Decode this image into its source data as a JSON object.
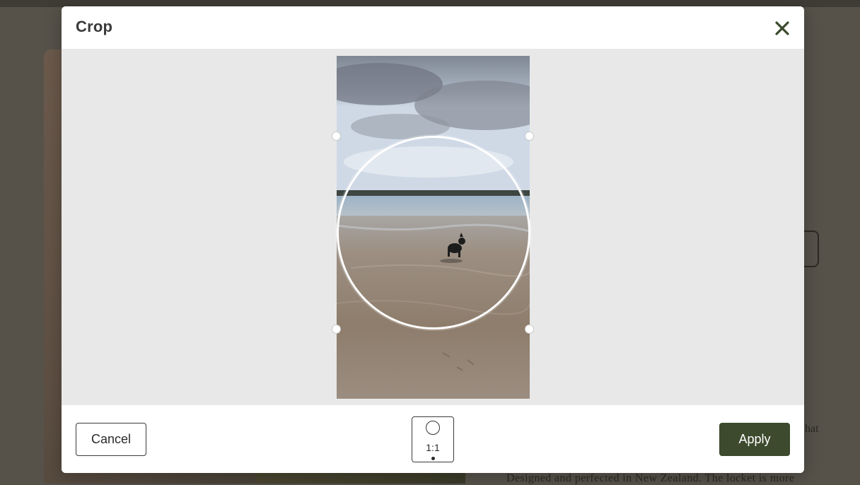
{
  "modal": {
    "title": "Crop",
    "close_icon": "close-icon"
  },
  "crop": {
    "shape": "circle",
    "aspect_ratio": "1:1"
  },
  "footer": {
    "cancel_label": "Cancel",
    "apply_label": "Apply",
    "ratio_options": [
      {
        "label": "1:1",
        "icon": "circle-icon",
        "selected": true
      }
    ]
  },
  "background_page": {
    "text_fragment": "hat",
    "description": "Designed and perfected in New Zealand. The locket is more"
  },
  "colors": {
    "apply_button": "#3d4a2d",
    "crop_area": "#e8e8e8",
    "overlay": "#56524a"
  }
}
